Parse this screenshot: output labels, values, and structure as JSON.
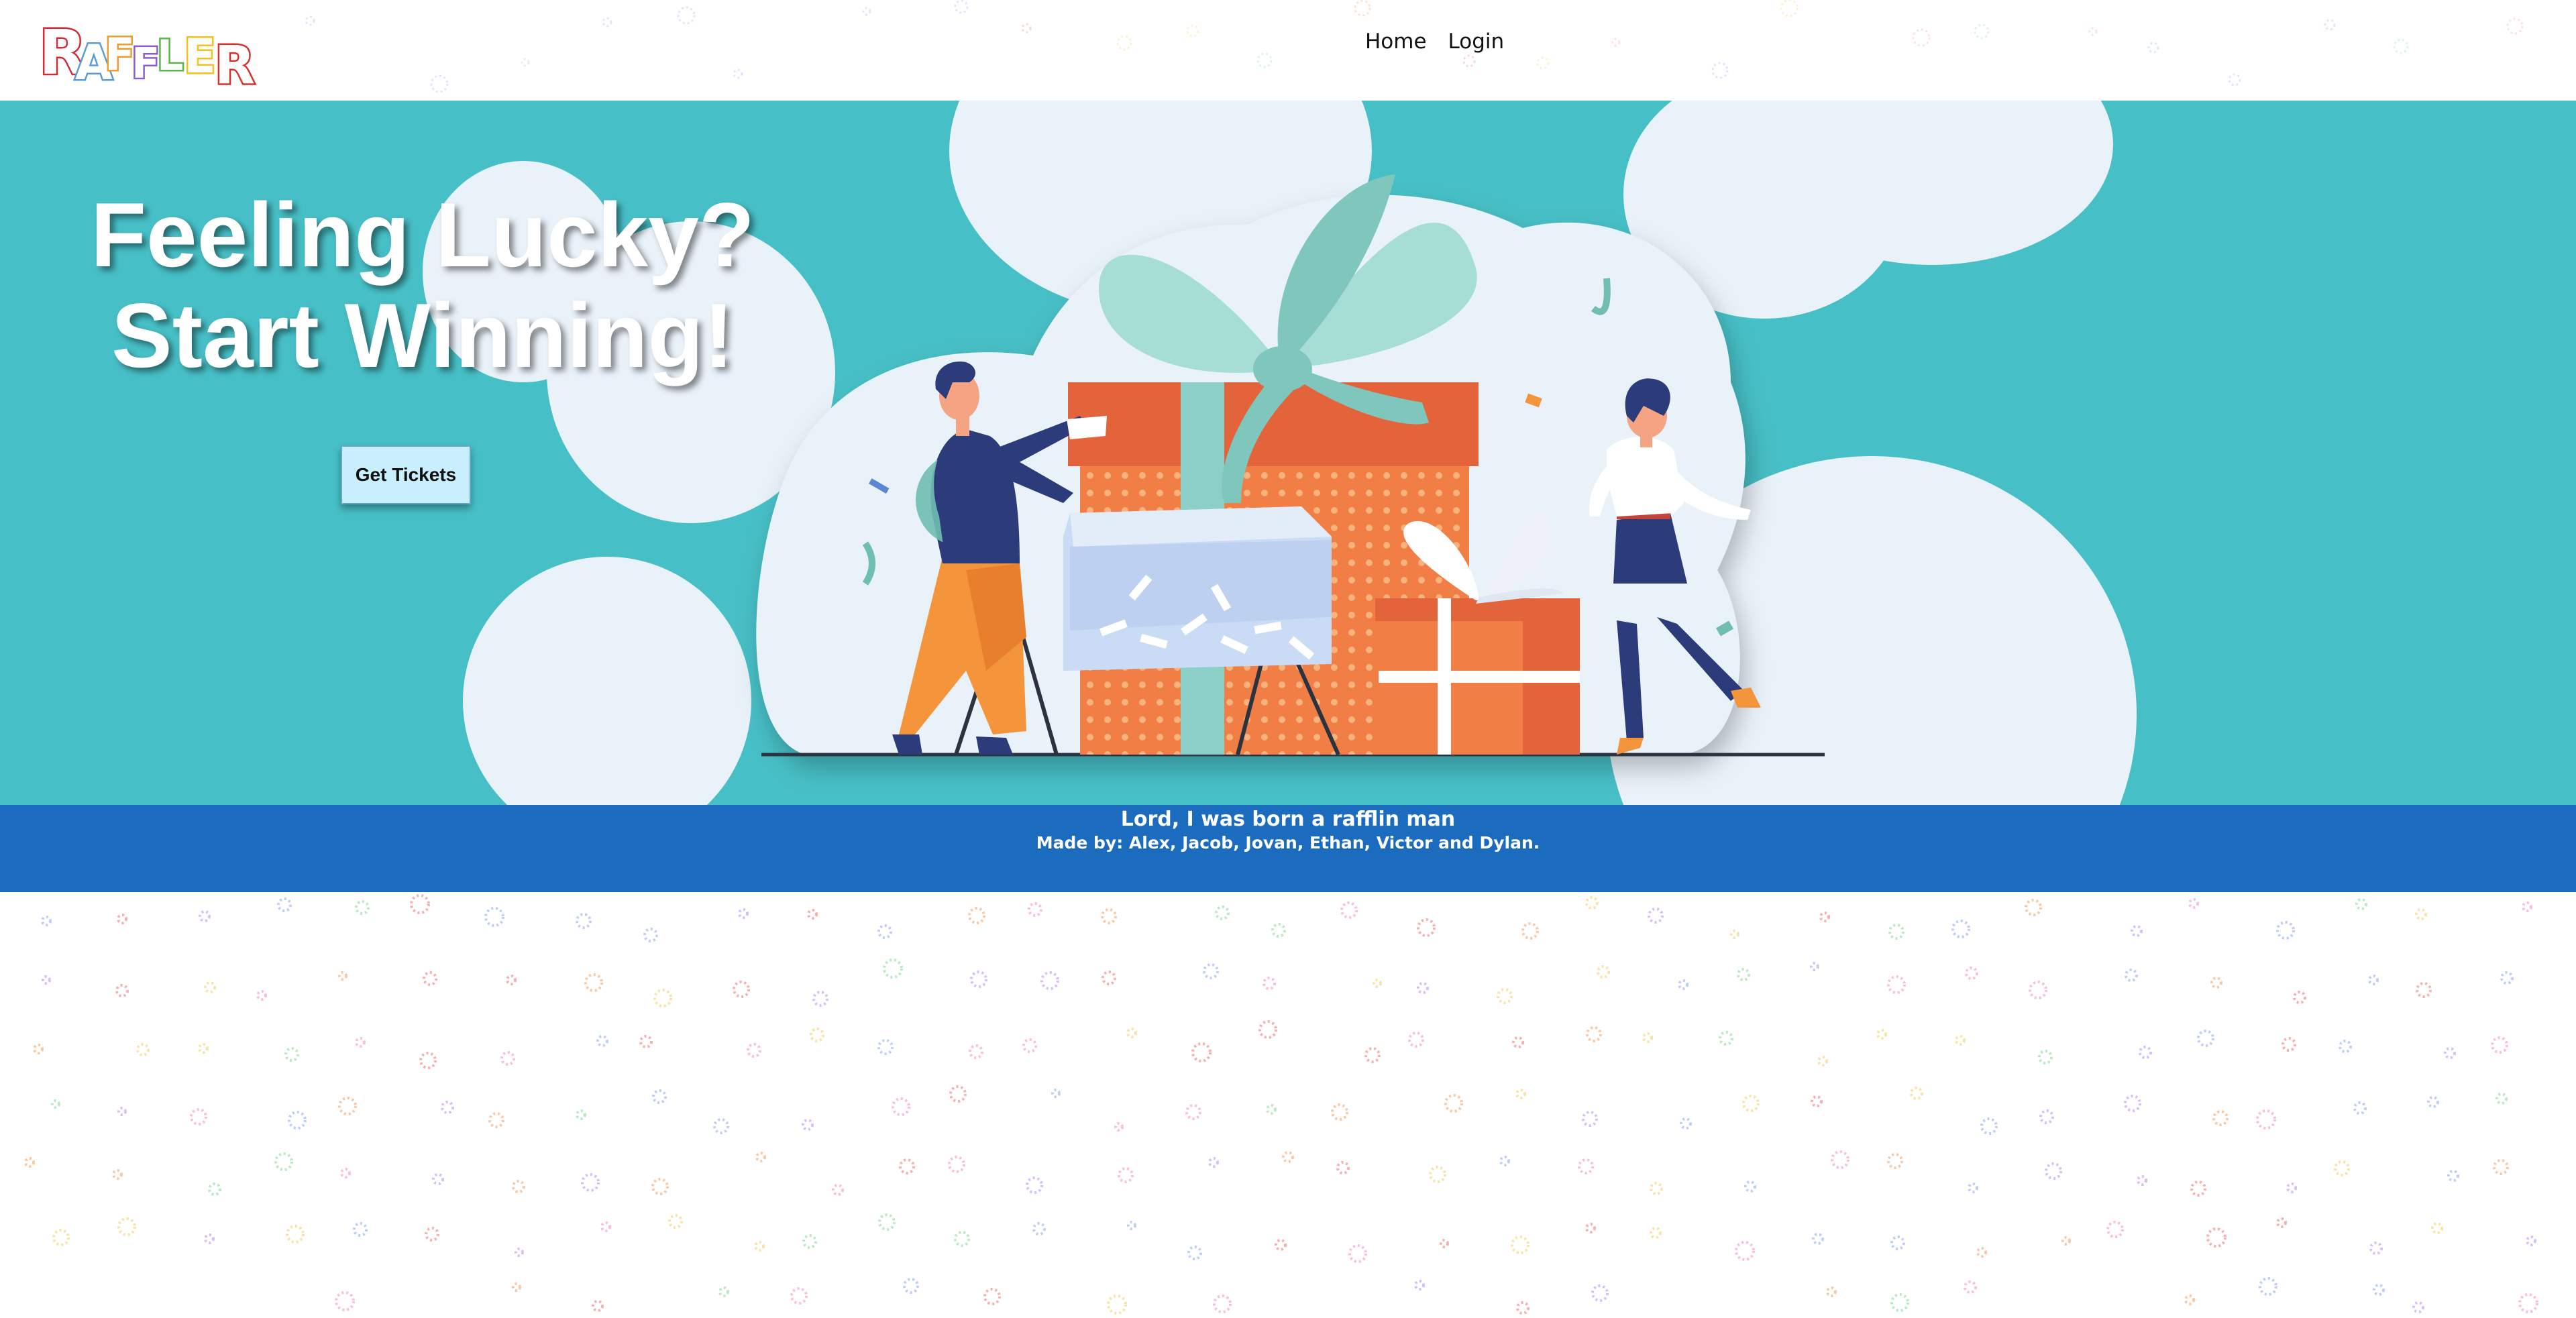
{
  "brand": {
    "logo_text": "RAFFLER"
  },
  "nav": {
    "home_label": "Home",
    "login_label": "Login"
  },
  "hero": {
    "headline_line1": "Feeling Lucky?",
    "headline_line2": "Start Winning!",
    "cta_label": "Get Tickets"
  },
  "footer": {
    "title": "Lord, I was born a rafflin man",
    "credits": "Made by: Alex, Jacob, Jovan, Ethan, Victor and Dylan."
  },
  "colors": {
    "hero_bg": "#47bfc6",
    "cloud": "#e9f1f9",
    "footer_bg": "#1b6bbf",
    "gift_orange": "#e8673a",
    "ribbon_mint": "#a9ddd6",
    "figure_navy": "#2c3c7a",
    "cta_bg": "#c9efff"
  },
  "icons": {
    "logo": "raffler-logo-icon",
    "illustration": "raffle-gifts-illustration-icon",
    "confetti": "confetti-icon"
  }
}
